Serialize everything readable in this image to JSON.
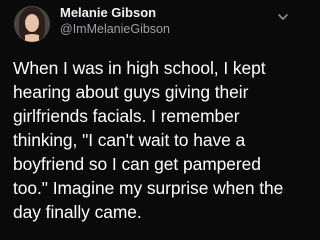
{
  "tweet": {
    "author": {
      "display_name": "Melanie Gibson",
      "handle": "@ImMelanieGibson",
      "avatar_icon": "profile-photo"
    },
    "menu_icon": "chevron-down-icon",
    "text": "When I was in high school, I kept hearing about guys giving their girlfriends facials. I remember thinking, \"I can't wait to have a boyfriend so I can get pampered too.\" Imagine my surprise when the day finally came."
  },
  "colors": {
    "background": "#0a0a0a",
    "text_primary": "#ffffff",
    "text_secondary": "#9aa0a6"
  }
}
